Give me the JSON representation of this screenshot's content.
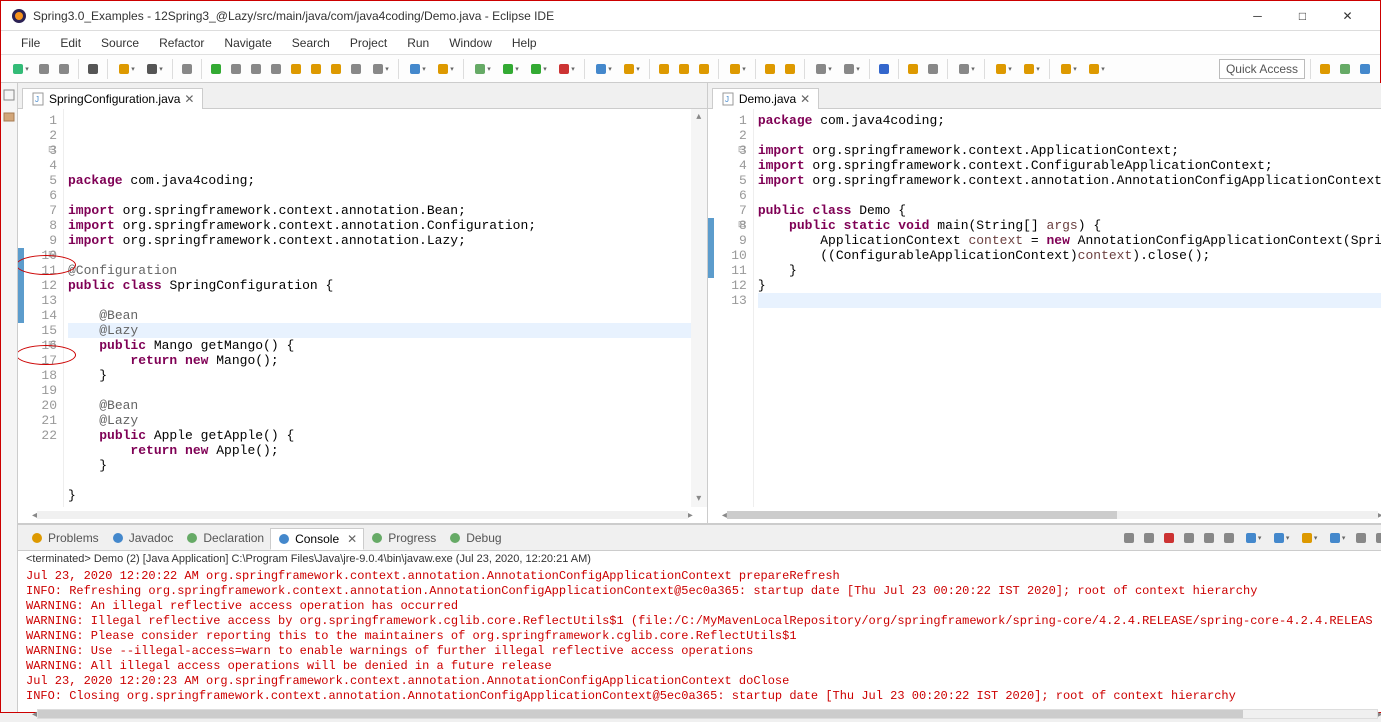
{
  "window": {
    "title": "Spring3.0_Examples - 12Spring3_@Lazy/src/main/java/com/java4coding/Demo.java - Eclipse IDE"
  },
  "menu": [
    "File",
    "Edit",
    "Source",
    "Refactor",
    "Navigate",
    "Search",
    "Project",
    "Run",
    "Window",
    "Help"
  ],
  "quick_access": "Quick Access",
  "editors": {
    "left": {
      "tab": "SpringConfiguration.java",
      "lines": [
        {
          "n": "1",
          "html": "<span class='kw'>package</span> com.java4coding;"
        },
        {
          "n": "2",
          "html": ""
        },
        {
          "n": "3",
          "fold": "⊟",
          "html": "<span class='kw'>import</span> org.springframework.context.annotation.Bean;"
        },
        {
          "n": "4",
          "html": "<span class='kw'>import</span> org.springframework.context.annotation.Configuration;"
        },
        {
          "n": "5",
          "html": "<span class='kw'>import</span> org.springframework.context.annotation.Lazy;"
        },
        {
          "n": "6",
          "html": ""
        },
        {
          "n": "7",
          "html": "<span class='ann'>@Configuration</span>"
        },
        {
          "n": "8",
          "html": "<span class='kw'>public</span> <span class='kw'>class</span> SpringConfiguration {"
        },
        {
          "n": "9",
          "html": ""
        },
        {
          "n": "10",
          "fold": "⊟",
          "mark": true,
          "html": "    <span class='ann'>@Bean</span>"
        },
        {
          "n": "11",
          "mark": true,
          "hl": true,
          "html": "    <span class='ann'>@Lazy</span>"
        },
        {
          "n": "12",
          "mark": true,
          "html": "    <span class='kw'>public</span> Mango getMango() {"
        },
        {
          "n": "13",
          "mark": true,
          "html": "        <span class='kw'>return</span> <span class='kw'>new</span> Mango();"
        },
        {
          "n": "14",
          "mark": true,
          "html": "    }"
        },
        {
          "n": "15",
          "html": ""
        },
        {
          "n": "16",
          "fold": "⊟",
          "html": "    <span class='ann'>@Bean</span>"
        },
        {
          "n": "17",
          "html": "    <span class='ann'>@Lazy</span>"
        },
        {
          "n": "18",
          "html": "    <span class='kw'>public</span> Apple getApple() {"
        },
        {
          "n": "19",
          "html": "        <span class='kw'>return</span> <span class='kw'>new</span> Apple();"
        },
        {
          "n": "20",
          "html": "    }"
        },
        {
          "n": "21",
          "html": ""
        },
        {
          "n": "22",
          "html": "}"
        }
      ]
    },
    "right": {
      "tab": "Demo.java",
      "lines": [
        {
          "n": "1",
          "html": "<span class='kw'>package</span> com.java4coding;"
        },
        {
          "n": "2",
          "html": ""
        },
        {
          "n": "3",
          "fold": "⊟",
          "html": "<span class='kw'>import</span> org.springframework.context.ApplicationContext;"
        },
        {
          "n": "4",
          "html": "<span class='kw'>import</span> org.springframework.context.ConfigurableApplicationContext;"
        },
        {
          "n": "5",
          "html": "<span class='kw'>import</span> org.springframework.context.annotation.AnnotationConfigApplicationContext;"
        },
        {
          "n": "6",
          "html": ""
        },
        {
          "n": "7",
          "html": "<span class='kw'>public</span> <span class='kw'>class</span> Demo {"
        },
        {
          "n": "8",
          "fold": "⊟",
          "mark": true,
          "html": "    <span class='kw'>public</span> <span class='kw'>static</span> <span class='kw'>void</span> main(String[] <span class='var'>args</span>) {"
        },
        {
          "n": "9",
          "mark": true,
          "html": "        ApplicationContext <span class='var'>context</span> = <span class='kw'>new</span> AnnotationConfigApplicationContext(SpringConfigurati"
        },
        {
          "n": "10",
          "mark": true,
          "html": "        ((ConfigurableApplicationContext)<span class='var'>context</span>).close();"
        },
        {
          "n": "11",
          "mark": true,
          "html": "    }"
        },
        {
          "n": "12",
          "html": "}"
        },
        {
          "n": "13",
          "hl": true,
          "html": ""
        }
      ]
    }
  },
  "bottom_tabs": [
    {
      "label": "Problems",
      "icon": "warning-icon",
      "active": false
    },
    {
      "label": "Javadoc",
      "icon": "at-icon",
      "active": false
    },
    {
      "label": "Declaration",
      "icon": "decl-icon",
      "active": false
    },
    {
      "label": "Console",
      "icon": "console-icon",
      "active": true,
      "close": true
    },
    {
      "label": "Progress",
      "icon": "progress-icon",
      "active": false
    },
    {
      "label": "Debug",
      "icon": "debug-icon",
      "active": false
    }
  ],
  "console": {
    "header": "<terminated> Demo (2) [Java Application] C:\\Program Files\\Java\\jre-9.0.4\\bin\\javaw.exe (Jul 23, 2020, 12:20:21 AM)",
    "lines": [
      {
        "cls": "red",
        "text": "Jul 23, 2020 12:20:22 AM org.springframework.context.annotation.AnnotationConfigApplicationContext prepareRefresh"
      },
      {
        "cls": "red",
        "text": "INFO: Refreshing org.springframework.context.annotation.AnnotationConfigApplicationContext@5ec0a365: startup date [Thu Jul 23 00:20:22 IST 2020]; root of context hierarchy"
      },
      {
        "cls": "red",
        "text": "WARNING: An illegal reflective access operation has occurred"
      },
      {
        "cls": "red",
        "text": "WARNING: Illegal reflective access by org.springframework.cglib.core.ReflectUtils$1 (file:/C:/MyMavenLocalRepository/org/springframework/spring-core/4.2.4.RELEASE/spring-core-4.2.4.RELEAS"
      },
      {
        "cls": "red",
        "text": "WARNING: Please consider reporting this to the maintainers of org.springframework.cglib.core.ReflectUtils$1"
      },
      {
        "cls": "red",
        "text": "WARNING: Use --illegal-access=warn to enable warnings of further illegal reflective access operations"
      },
      {
        "cls": "red",
        "text": "WARNING: All illegal access operations will be denied in a future release"
      },
      {
        "cls": "red",
        "text": "Jul 23, 2020 12:20:23 AM org.springframework.context.annotation.AnnotationConfigApplicationContext doClose"
      },
      {
        "cls": "red",
        "text": "INFO: Closing org.springframework.context.annotation.AnnotationConfigApplicationContext@5ec0a365: startup date [Thu Jul 23 00:20:22 IST 2020]; root of context hierarchy"
      }
    ]
  },
  "toolbar_icons": [
    {
      "n": "new-icon",
      "c": "#3b7",
      "dd": true
    },
    {
      "n": "save-icon",
      "c": "#888"
    },
    {
      "n": "saveall-icon",
      "c": "#888"
    },
    {
      "sep": true
    },
    {
      "n": "build-icon",
      "c": "#555"
    },
    {
      "sep": true
    },
    {
      "n": "open-type-icon",
      "c": "#d90",
      "dd": true
    },
    {
      "n": "search-icon",
      "c": "#555",
      "dd": true
    },
    {
      "sep": true
    },
    {
      "n": "toggle-icon",
      "c": "#888"
    },
    {
      "sep": true
    },
    {
      "n": "run-last-icon",
      "c": "#3a3"
    },
    {
      "n": "pause-icon",
      "c": "#888"
    },
    {
      "n": "stop-icon",
      "c": "#888"
    },
    {
      "n": "disconnect-icon",
      "c": "#888"
    },
    {
      "n": "stepinto-icon",
      "c": "#d90"
    },
    {
      "n": "stepover-icon",
      "c": "#d90"
    },
    {
      "n": "stepreturn-icon",
      "c": "#d90"
    },
    {
      "n": "drop-icon",
      "c": "#888"
    },
    {
      "n": "stepfilters-icon",
      "c": "#888",
      "dd": true
    },
    {
      "sep": true
    },
    {
      "n": "newclass-icon",
      "c": "#48c",
      "dd": true
    },
    {
      "n": "newpkg-icon",
      "c": "#d90",
      "dd": true
    },
    {
      "sep": true
    },
    {
      "n": "debug-icon",
      "c": "#6a6",
      "dd": true
    },
    {
      "n": "run-icon",
      "c": "#3a3",
      "dd": true
    },
    {
      "n": "coverage-icon",
      "c": "#3a3",
      "dd": true
    },
    {
      "n": "ext-tools-icon",
      "c": "#c33",
      "dd": true
    },
    {
      "sep": true
    },
    {
      "n": "newproj-icon",
      "c": "#48c",
      "dd": true
    },
    {
      "n": "newsrv-icon",
      "c": "#d90",
      "dd": true
    },
    {
      "sep": true
    },
    {
      "n": "open-task-icon",
      "c": "#d90"
    },
    {
      "n": "open-res-icon",
      "c": "#d90"
    },
    {
      "n": "nav-icon",
      "c": "#d90"
    },
    {
      "sep": true
    },
    {
      "n": "open-pkg-icon",
      "c": "#d90",
      "dd": true
    },
    {
      "sep": true
    },
    {
      "n": "search2-icon",
      "c": "#d90"
    },
    {
      "n": "annot-icon",
      "c": "#d90"
    },
    {
      "sep": true
    },
    {
      "n": "prev-annot-icon",
      "c": "#888",
      "dd": true
    },
    {
      "n": "next-annot-icon",
      "c": "#888",
      "dd": true
    },
    {
      "sep": true
    },
    {
      "n": "pilrow-icon",
      "c": "#36c"
    },
    {
      "sep": true
    },
    {
      "n": "block-sel-icon",
      "c": "#d90"
    },
    {
      "n": "show-ws-icon",
      "c": "#888"
    },
    {
      "sep": true
    },
    {
      "n": "pin-icon",
      "c": "#888",
      "dd": true
    },
    {
      "sep": true
    },
    {
      "n": "back-icon",
      "c": "#d90",
      "dd": true
    },
    {
      "n": "fwd-icon",
      "c": "#d90",
      "dd": true
    },
    {
      "sep": true
    },
    {
      "n": "back2-icon",
      "c": "#d90",
      "dd": true
    },
    {
      "n": "fwd2-icon",
      "c": "#d90",
      "dd": true
    }
  ],
  "persp_icons": [
    {
      "n": "open-persp-icon",
      "c": "#d90"
    },
    {
      "n": "debug-persp-icon",
      "c": "#6a6"
    },
    {
      "n": "java-persp-icon",
      "c": "#48c"
    }
  ],
  "console_icons": [
    {
      "n": "terminate-icon",
      "c": "#888"
    },
    {
      "n": "removeall-icon",
      "c": "#888"
    },
    {
      "n": "removelaunch-icon",
      "c": "#c33"
    },
    {
      "sep": true
    },
    {
      "n": "clear-icon",
      "c": "#888"
    },
    {
      "n": "scroll-lock-icon",
      "c": "#888"
    },
    {
      "n": "wordwrap-icon",
      "c": "#888"
    },
    {
      "n": "show-console-icon",
      "c": "#48c",
      "dd": true
    },
    {
      "n": "pin-console-icon",
      "c": "#48c",
      "dd": true
    },
    {
      "sep": true
    },
    {
      "n": "display-console-icon",
      "c": "#d90",
      "dd": true
    },
    {
      "n": "open-console-icon",
      "c": "#48c",
      "dd": true
    },
    {
      "sep": true
    },
    {
      "n": "min-icon",
      "c": "#888"
    },
    {
      "n": "max-icon",
      "c": "#888"
    }
  ]
}
